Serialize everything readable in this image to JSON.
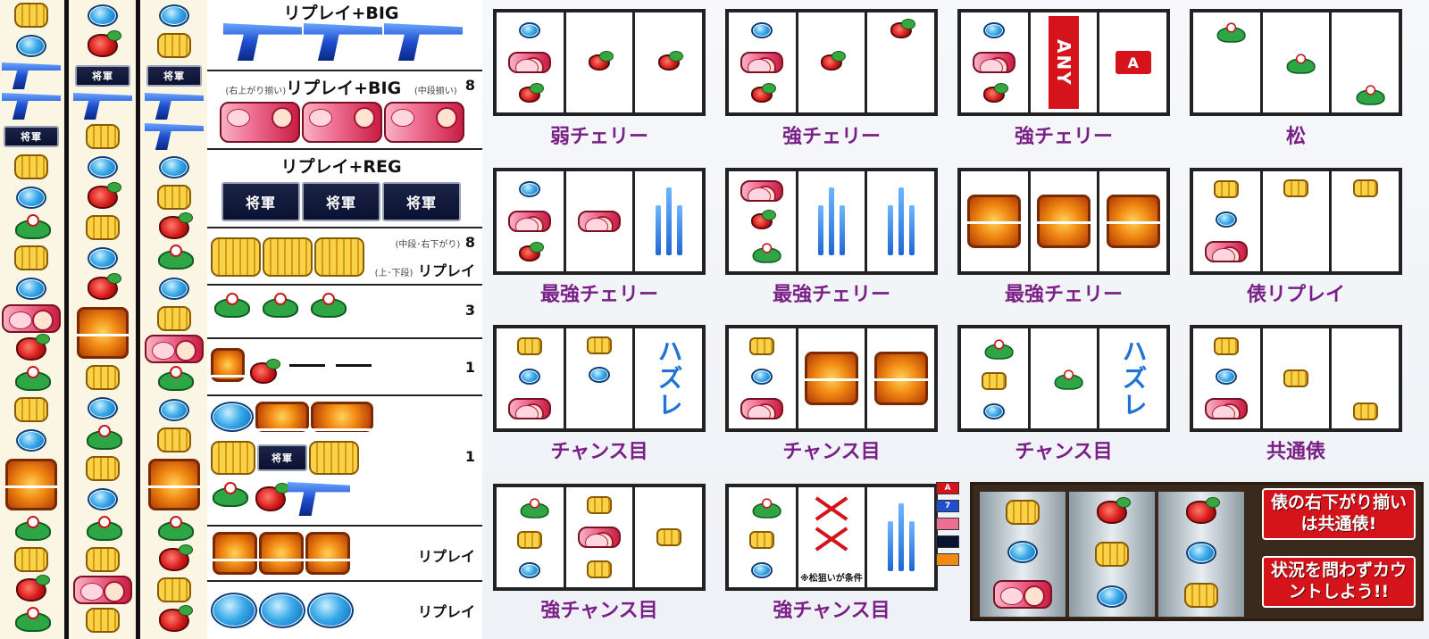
{
  "colors": {
    "label_purple": "#7a1f86",
    "frame_dark": "#222222",
    "hazure_blue": "#1f73d6",
    "alert_red": "#d4131b",
    "reel_bg": "#fbf6e4"
  },
  "symbols": [
    "replay",
    "bell",
    "pine",
    "cherry",
    "seven",
    "shogun",
    "girl",
    "gold"
  ],
  "reels": {
    "left": [
      "bell",
      "replay",
      "seven",
      "seven",
      "shogun",
      "bell",
      "replay",
      "pine",
      "bell",
      "replay",
      "girl",
      "cherry",
      "pine",
      "bell",
      "replay",
      "gold",
      "pine",
      "bell",
      "cherry",
      "pine"
    ],
    "center": [
      "replay",
      "cherry",
      "shogun",
      "seven",
      "bell",
      "replay",
      "cherry",
      "bell",
      "replay",
      "cherry",
      "gold",
      "bell",
      "replay",
      "pine",
      "bell",
      "replay",
      "pine",
      "bell",
      "girl",
      "bell"
    ],
    "right": [
      "replay",
      "bell",
      "shogun",
      "seven",
      "seven",
      "replay",
      "bell",
      "cherry",
      "pine",
      "replay",
      "bell",
      "girl",
      "pine",
      "replay",
      "bell",
      "gold",
      "pine",
      "cherry",
      "bell",
      "cherry"
    ]
  },
  "paytable": [
    {
      "title": "リプレイ+BIG",
      "symbols": [
        "seven",
        "seven",
        "seven"
      ],
      "value": ""
    },
    {
      "title": "リプレイ+BIG",
      "prefix_note": "(右上がり揃い)",
      "suffix_note": "(中段揃い)",
      "symbols": [
        "girl",
        "girl",
        "girl"
      ],
      "value": "8"
    },
    {
      "title": "リプレイ+REG",
      "symbols": [
        "shogun",
        "shogun",
        "shogun"
      ],
      "value": ""
    },
    {
      "title": "",
      "symbols": [
        "bell",
        "bell",
        "bell"
      ],
      "value": "8",
      "note_top": "(中段･右下がり)",
      "note_bottom": "(上･下段)",
      "value2": "リプレイ"
    },
    {
      "title": "",
      "symbols": [
        "pine",
        "pine",
        "pine"
      ],
      "value": "3"
    },
    {
      "title": "",
      "symbols": [
        "gold",
        "cherry"
      ],
      "dashes": true,
      "value": "1"
    },
    {
      "title": "",
      "symbols": [
        "replay",
        "gold",
        "gold",
        "bell",
        "shogun",
        "bell",
        "pine",
        "cherry",
        "seven"
      ],
      "value": "1"
    },
    {
      "title": "",
      "symbols": [
        "gold",
        "gold",
        "gold"
      ],
      "value": "リプレイ"
    },
    {
      "title": "",
      "symbols": [
        "replay",
        "replay",
        "replay"
      ],
      "value": "リプレイ"
    }
  ],
  "cards": [
    {
      "label": "弱チェリー"
    },
    {
      "label": "強チェリー"
    },
    {
      "label": "強チェリー",
      "any_text": "ANY",
      "a_text": "A"
    },
    {
      "label": "松"
    },
    {
      "label": "最強チェリー"
    },
    {
      "label": "最強チェリー"
    },
    {
      "label": "最強チェリー"
    },
    {
      "label": "俵リプレイ"
    },
    {
      "label": "チャンス目",
      "hazure": "ハズレ"
    },
    {
      "label": "チャンス目"
    },
    {
      "label": "チャンス目",
      "hazure": "ハズレ"
    },
    {
      "label": "共通俵"
    },
    {
      "label": "強チャンス目"
    },
    {
      "label": "強チャンス目",
      "note": "※松狙いが条件"
    }
  ],
  "legend_mini": [
    "A",
    "7",
    "girl",
    "shogun",
    "gold"
  ],
  "callout": {
    "line1": "俵の右下がり揃いは共通俵!",
    "line2": "状況を問わずカウントしよう!!"
  }
}
